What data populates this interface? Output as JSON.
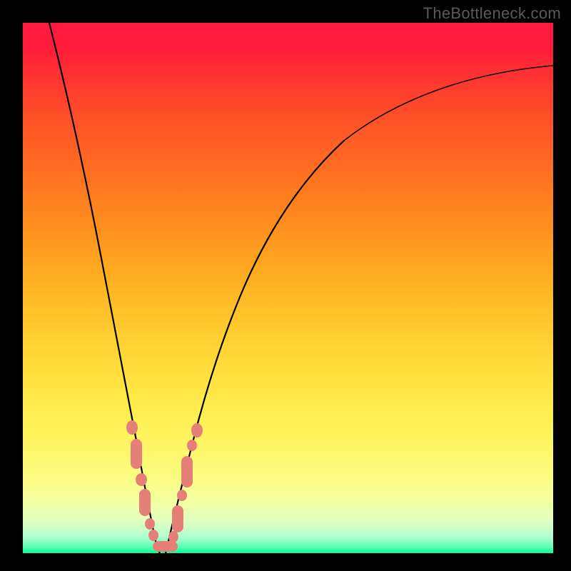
{
  "watermark": "TheBottleneck.com",
  "chart_data": {
    "type": "line",
    "title": "",
    "xlabel": "",
    "ylabel": "",
    "xlim": [
      0,
      100
    ],
    "ylim": [
      0,
      100
    ],
    "curves": [
      {
        "name": "left-descending",
        "x": [
          5,
          8,
          11,
          14,
          16,
          18,
          19.5,
          21,
          22,
          23,
          24,
          25
        ],
        "values": [
          100,
          88,
          73,
          57,
          44,
          33,
          24,
          16,
          10,
          5,
          2,
          0
        ]
      },
      {
        "name": "right-ascending",
        "x": [
          25,
          27,
          29,
          32,
          36,
          42,
          50,
          60,
          72,
          85,
          100
        ],
        "values": [
          0,
          6,
          14,
          25,
          38,
          52,
          64,
          74,
          82,
          88,
          92
        ]
      }
    ],
    "markers": {
      "left": [
        {
          "x": 19.5,
          "y": 24
        },
        {
          "x": 20.5,
          "y": 19
        },
        {
          "x": 21.3,
          "y": 15
        },
        {
          "x": 22.0,
          "y": 11
        },
        {
          "x": 22.8,
          "y": 7
        },
        {
          "x": 23.5,
          "y": 4
        },
        {
          "x": 24.3,
          "y": 1.5
        },
        {
          "x": 25.0,
          "y": 0.3
        }
      ],
      "right": [
        {
          "x": 26.8,
          "y": 0.5
        },
        {
          "x": 27.8,
          "y": 3
        },
        {
          "x": 29.0,
          "y": 8
        },
        {
          "x": 30.0,
          "y": 13
        },
        {
          "x": 31.0,
          "y": 18
        },
        {
          "x": 32.2,
          "y": 23
        }
      ]
    },
    "colors": {
      "curve": "#000000",
      "marker": "#e58078",
      "gradient_top": "#ff1840",
      "gradient_bottom": "#00ff90"
    }
  }
}
